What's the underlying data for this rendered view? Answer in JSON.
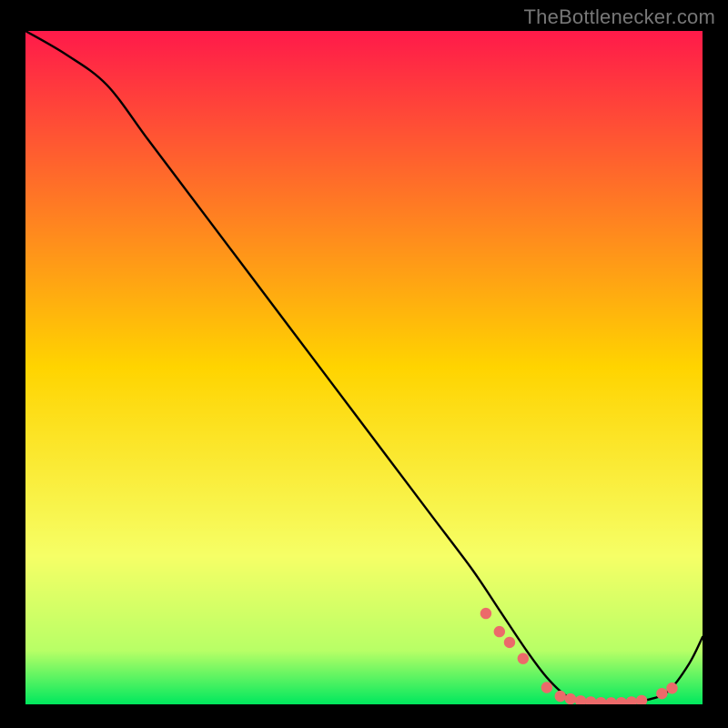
{
  "attribution": "TheBottlenecker.com",
  "colors": {
    "frame": "#000000",
    "text": "#777777",
    "curve": "#000000",
    "dots": "#ec6a6a",
    "grad_top": "#ff1a4a",
    "grad_mid": "#ffd400",
    "grad_low1": "#f6ff66",
    "grad_low2": "#b8ff66",
    "grad_bottom": "#00e85e"
  },
  "chart_data": {
    "type": "line",
    "title": "",
    "xlabel": "",
    "ylabel": "",
    "xlim": [
      0,
      100
    ],
    "ylim": [
      0,
      100
    ],
    "x": [
      0,
      6,
      12,
      18,
      24,
      30,
      36,
      42,
      48,
      54,
      60,
      66,
      70,
      74,
      77,
      80,
      83,
      86,
      89,
      92,
      95,
      98,
      100
    ],
    "values": [
      100,
      96.5,
      92,
      84,
      76,
      68,
      60,
      52,
      44,
      36,
      28,
      20,
      14,
      8,
      4,
      1.2,
      0.4,
      0.2,
      0.3,
      0.7,
      2,
      6,
      10
    ],
    "dots_x": [
      68,
      70,
      71.5,
      73.5,
      77,
      79,
      80.5,
      82,
      83.5,
      85,
      86.5,
      88,
      89.5,
      91,
      94,
      95.5
    ],
    "dots_y": [
      13.5,
      10.8,
      9.2,
      6.8,
      2.5,
      1.2,
      0.8,
      0.5,
      0.35,
      0.25,
      0.22,
      0.25,
      0.35,
      0.55,
      1.6,
      2.4
    ]
  }
}
